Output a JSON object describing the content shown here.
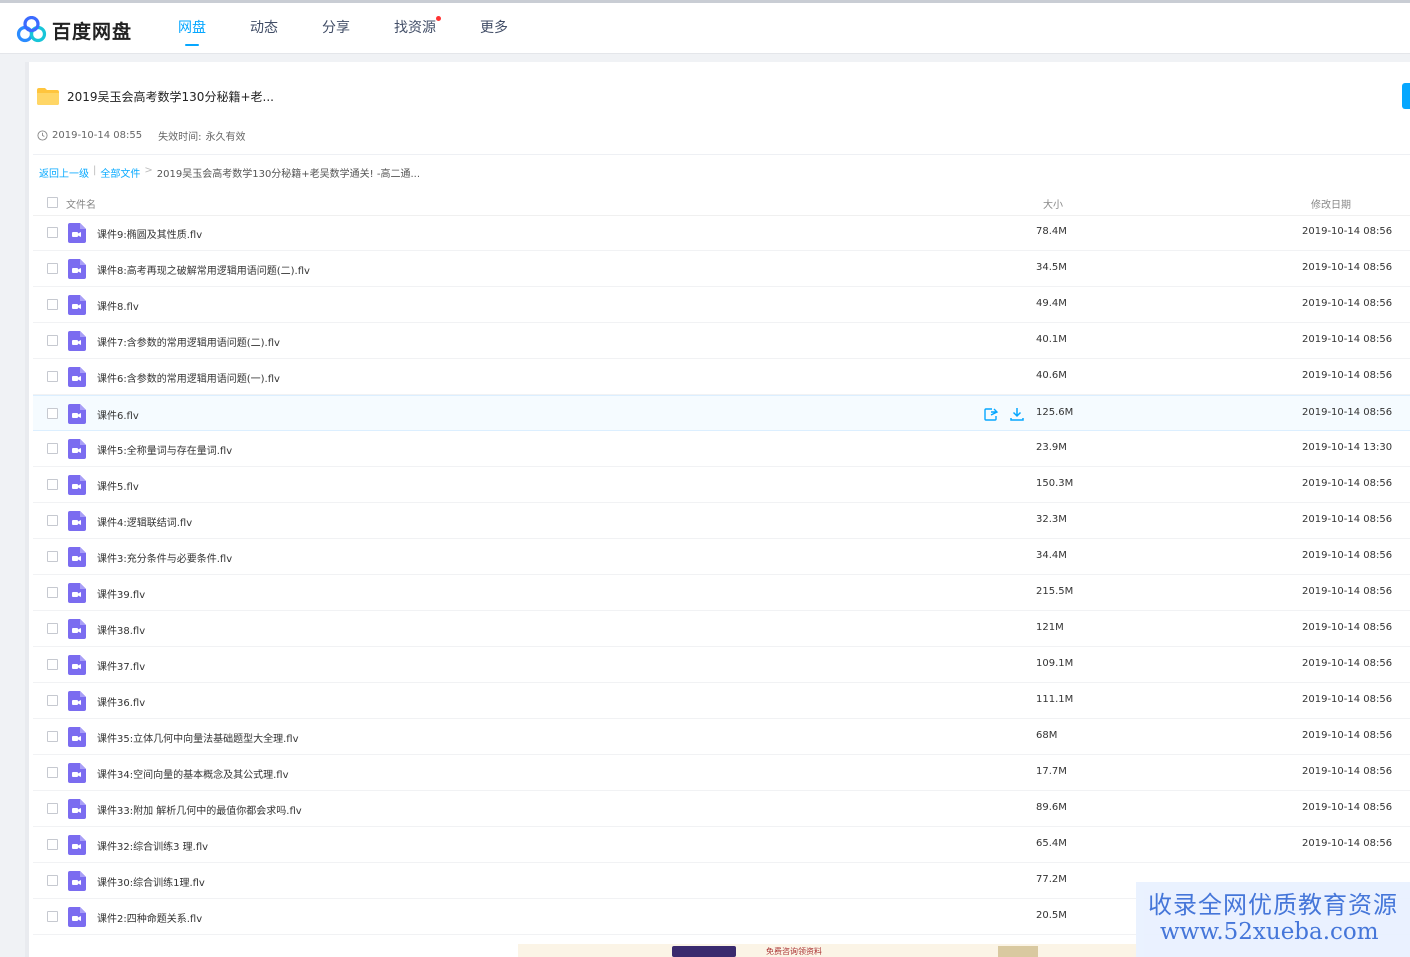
{
  "app": {
    "logo_text": "百度网盘"
  },
  "nav": [
    {
      "label": "网盘",
      "active": true
    },
    {
      "label": "动态"
    },
    {
      "label": "分享"
    },
    {
      "label": "找资源",
      "has_dot": true
    },
    {
      "label": "更多"
    }
  ],
  "folder": {
    "title": "2019吴玉会高考数学130分秘籍+老...",
    "created": "2019-10-14 08:55",
    "expire_label": "失效时间:",
    "expire_value": "永久有效"
  },
  "breadcrumb": {
    "back": "返回上一级",
    "sep1": "|",
    "all_files": "全部文件",
    "sep2": ">",
    "current": "2019吴玉会高考数学130分秘籍+老吴数学通关! -高二通..."
  },
  "table": {
    "headers": {
      "name": "文件名",
      "size": "大小",
      "date": "修改日期"
    },
    "rows": [
      {
        "name": "课件9:椭圆及其性质.flv",
        "size": "78.4M",
        "date": "2019-10-14 08:56"
      },
      {
        "name": "课件8:高考再现之破解常用逻辑用语问题(二).flv",
        "size": "34.5M",
        "date": "2019-10-14 08:56"
      },
      {
        "name": "课件8.flv",
        "size": "49.4M",
        "date": "2019-10-14 08:56"
      },
      {
        "name": "课件7:含参数的常用逻辑用语问题(二).flv",
        "size": "40.1M",
        "date": "2019-10-14 08:56"
      },
      {
        "name": "课件6:含参数的常用逻辑用语问题(一).flv",
        "size": "40.6M",
        "date": "2019-10-14 08:56"
      },
      {
        "name": "课件6.flv",
        "size": "125.6M",
        "date": "2019-10-14 08:56",
        "hover": true
      },
      {
        "name": "课件5:全称量词与存在量词.flv",
        "size": "23.9M",
        "date": "2019-10-14 13:30"
      },
      {
        "name": "课件5.flv",
        "size": "150.3M",
        "date": "2019-10-14 08:56"
      },
      {
        "name": "课件4:逻辑联结词.flv",
        "size": "32.3M",
        "date": "2019-10-14 08:56"
      },
      {
        "name": "课件3:充分条件与必要条件.flv",
        "size": "34.4M",
        "date": "2019-10-14 08:56"
      },
      {
        "name": "课件39.flv",
        "size": "215.5M",
        "date": "2019-10-14 08:56"
      },
      {
        "name": "课件38.flv",
        "size": "121M",
        "date": "2019-10-14 08:56"
      },
      {
        "name": "课件37.flv",
        "size": "109.1M",
        "date": "2019-10-14 08:56"
      },
      {
        "name": "课件36.flv",
        "size": "111.1M",
        "date": "2019-10-14 08:56"
      },
      {
        "name": "课件35:立体几何中向量法基础题型大全理.flv",
        "size": "68M",
        "date": "2019-10-14 08:56"
      },
      {
        "name": "课件34:空间向量的基本概念及其公式理.flv",
        "size": "17.7M",
        "date": "2019-10-14 08:56"
      },
      {
        "name": "课件33:附加 解析几何中的最值你都会求吗.flv",
        "size": "89.6M",
        "date": "2019-10-14 08:56"
      },
      {
        "name": "课件32:综合训练3 理.flv",
        "size": "65.4M",
        "date": "2019-10-14 08:56"
      },
      {
        "name": "课件30:综合训练1理.flv",
        "size": "77.2M",
        "date": ""
      },
      {
        "name": "课件2:四种命题关系.flv",
        "size": "20.5M",
        "date": ""
      }
    ]
  },
  "ad": {
    "text": "免费咨询领资料"
  },
  "watermark": {
    "line1": "收录全网优质教育资源",
    "line2": "www.52xueba.com"
  },
  "icons": {
    "logo": "baidu-netdisk-logo-icon",
    "folder": "folder-icon",
    "clock": "clock-icon",
    "file": "video-file-icon",
    "share": "share-icon",
    "download": "download-icon"
  },
  "colors": {
    "accent": "#06a7ff",
    "folder": "#ffc53d",
    "video": "#7b6cf0",
    "watermark": "#3c6fd8"
  }
}
